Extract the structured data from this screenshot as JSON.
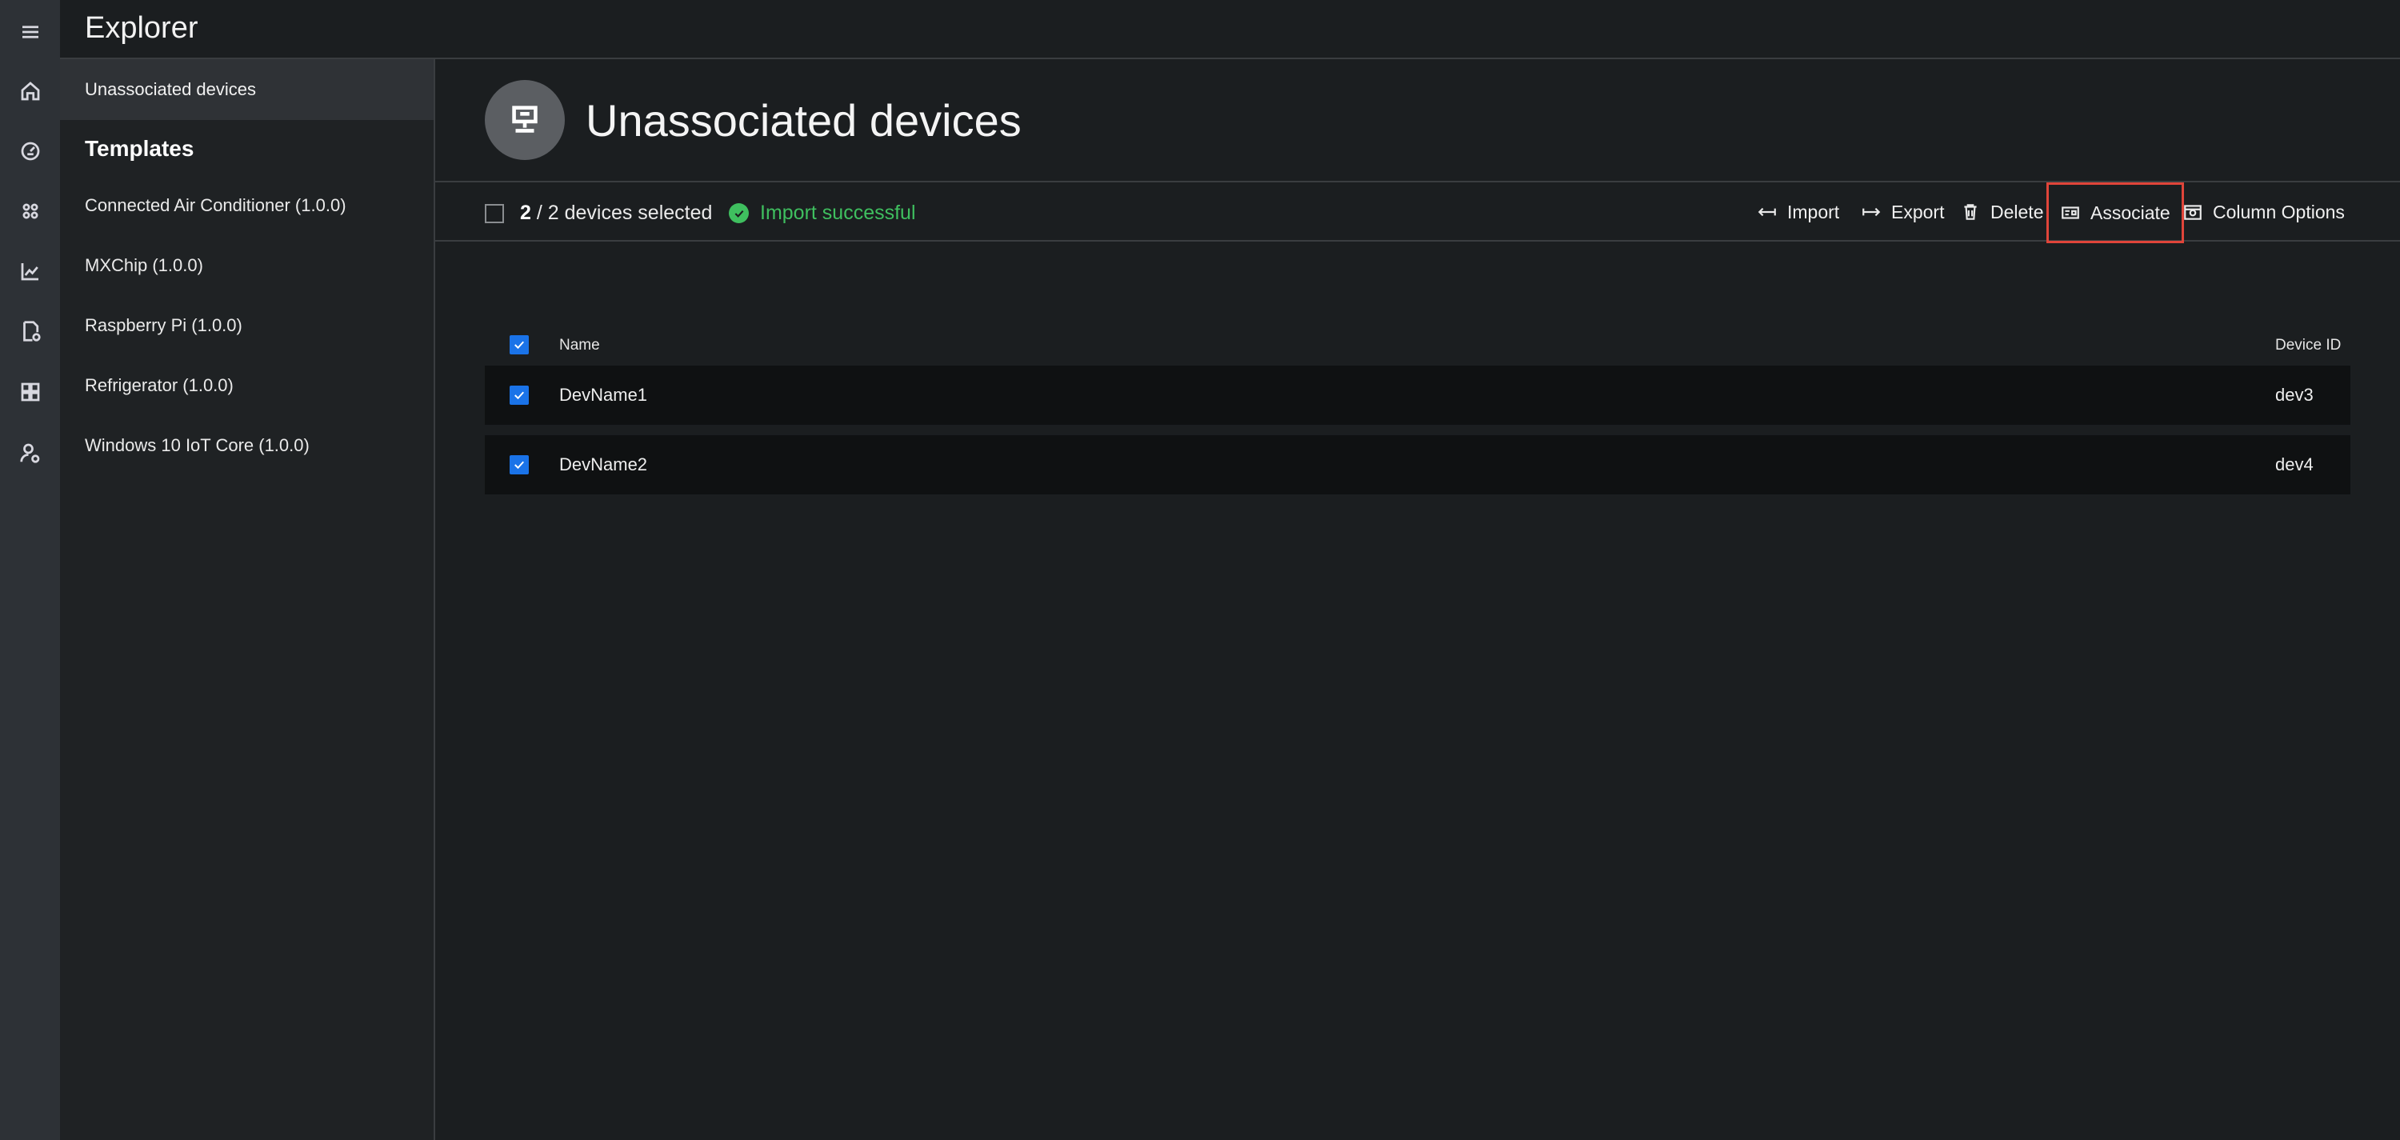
{
  "app": {
    "title": "Explorer"
  },
  "rail": {
    "icons": [
      "menu-icon",
      "home-icon",
      "dashboard-gauge-icon",
      "devices-grid-icon",
      "analytics-chart-icon",
      "device-template-icon",
      "dashboard-tiles-icon",
      "user-settings-icon"
    ]
  },
  "nav": {
    "selected": "Unassociated devices",
    "heading": "Templates",
    "items": [
      {
        "label": "Connected Air Conditioner (1.0.0)"
      },
      {
        "label": "MXChip (1.0.0)"
      },
      {
        "label": "Raspberry Pi (1.0.0)"
      },
      {
        "label": "Refrigerator (1.0.0)"
      },
      {
        "label": "Windows 10 IoT Core (1.0.0)"
      }
    ]
  },
  "main": {
    "title": "Unassociated devices",
    "selection": {
      "count": "2",
      "rest": " / 2 devices selected"
    },
    "status": "Import successful",
    "toolbar": {
      "import": "Import",
      "export": "Export",
      "delete": "Delete",
      "associate": "Associate",
      "column_options": "Column Options"
    },
    "table": {
      "columns": [
        "Name",
        "Device ID"
      ],
      "rows": [
        {
          "name": "DevName1",
          "device_id": "dev3",
          "checked": true
        },
        {
          "name": "DevName2",
          "device_id": "dev4",
          "checked": true
        }
      ]
    }
  },
  "colors": {
    "accent": "#1a73e8",
    "success": "#3fbf5f",
    "highlight": "#e0453a"
  }
}
